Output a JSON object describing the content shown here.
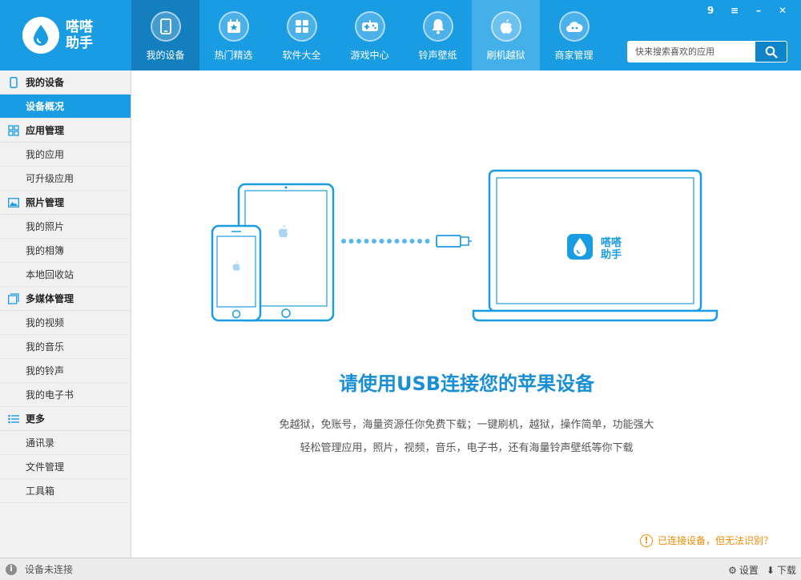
{
  "app": {
    "logo_line1": "嗒嗒",
    "logo_line2": "助手"
  },
  "nav": {
    "items": [
      {
        "label": "我的设备",
        "icon": "phone-icon"
      },
      {
        "label": "热门精选",
        "icon": "calendar-star-icon"
      },
      {
        "label": "软件大全",
        "icon": "grid-icon"
      },
      {
        "label": "游戏中心",
        "icon": "gamepad-icon"
      },
      {
        "label": "铃声壁纸",
        "icon": "bell-icon"
      },
      {
        "label": "刷机越狱",
        "icon": "apple-icon"
      },
      {
        "label": "商家管理",
        "icon": "cloud-icon"
      }
    ],
    "active_index": 0
  },
  "window": {
    "badge_count": "9",
    "menu_glyph": "≡",
    "minimize_glyph": "–",
    "close_glyph": "✕"
  },
  "search": {
    "placeholder": "快来搜索喜欢的应用"
  },
  "sidebar": {
    "sections": [
      {
        "title": "我的设备",
        "icon": "phone-icon",
        "items": [
          "设备概况"
        ]
      },
      {
        "title": "应用管理",
        "icon": "apps-grid-icon",
        "items": [
          "我的应用",
          "可升级应用"
        ]
      },
      {
        "title": "照片管理",
        "icon": "photo-icon",
        "items": [
          "我的照片",
          "我的相簿",
          "本地回收站"
        ]
      },
      {
        "title": "多媒体管理",
        "icon": "media-icon",
        "items": [
          "我的视频",
          "我的音乐",
          "我的铃声",
          "我的电子书"
        ]
      },
      {
        "title": "更多",
        "icon": "list-icon",
        "items": [
          "通讯录",
          "文件管理",
          "工具箱"
        ]
      }
    ],
    "active_item": "设备概况"
  },
  "main": {
    "title": "请使用USB连接您的苹果设备",
    "desc_line1": "免越狱，免账号，海量资源任你免费下载；一键刷机，越狱，操作简单，功能强大",
    "desc_line2": "轻松管理应用，照片，视频，音乐，电子书，还有海量铃声壁纸等你下载",
    "laptop_logo_line1": "嗒嗒",
    "laptop_logo_line2": "助手",
    "help_text": "已连接设备，但无法识别？"
  },
  "statusbar": {
    "status_text": "设备未连接",
    "settings_label": "设置",
    "download_label": "下载"
  },
  "colors": {
    "brand": "#1a9ce2",
    "brand_dark": "#137fbf",
    "title": "#1a8fd3",
    "warning": "#f08c00"
  }
}
